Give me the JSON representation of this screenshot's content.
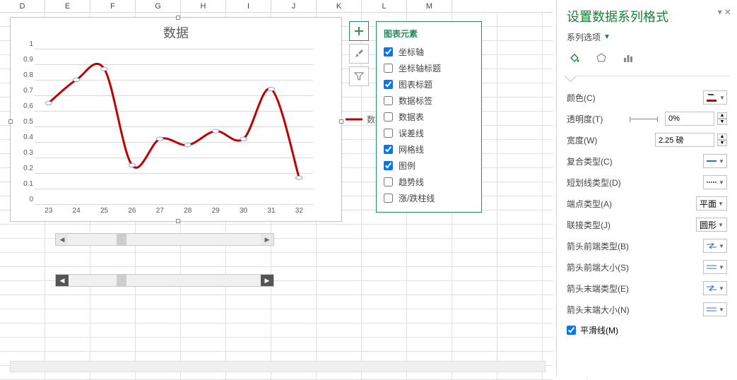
{
  "columns": [
    "D",
    "E",
    "F",
    "G",
    "H",
    "I",
    "J",
    "K",
    "L",
    "M"
  ],
  "chart_data": {
    "type": "line",
    "title": "数据",
    "categories": [
      "23",
      "24",
      "25",
      "26",
      "27",
      "28",
      "29",
      "30",
      "31",
      "32"
    ],
    "series": [
      {
        "name": "数据",
        "values": [
          0.65,
          0.8,
          0.87,
          0.25,
          0.42,
          0.38,
          0.47,
          0.42,
          0.74,
          0.17
        ]
      }
    ],
    "ylim": [
      0,
      1
    ],
    "yticks": [
      "0",
      "0.1",
      "0.2",
      "0.3",
      "0.4",
      "0.5",
      "0.6",
      "0.7",
      "0.8",
      "0.9",
      "1"
    ],
    "xlabel": "",
    "ylabel": "",
    "line_color": "#c00000"
  },
  "flyout": {
    "title": "图表元素",
    "items": [
      {
        "label": "坐标轴",
        "checked": true
      },
      {
        "label": "坐标轴标题",
        "checked": false
      },
      {
        "label": "图表标题",
        "checked": true
      },
      {
        "label": "数据标签",
        "checked": false
      },
      {
        "label": "数据表",
        "checked": false
      },
      {
        "label": "误差线",
        "checked": false
      },
      {
        "label": "网格线",
        "checked": true
      },
      {
        "label": "图例",
        "checked": true
      },
      {
        "label": "趋势线",
        "checked": false
      },
      {
        "label": "涨/跌柱线",
        "checked": false
      }
    ]
  },
  "panel": {
    "title": "设置数据系列格式",
    "subtitle": "系列选项",
    "color_label": "颜色(C)",
    "transparency_label": "透明度(T)",
    "transparency_value": "0%",
    "width_label": "宽度(W)",
    "width_value": "2.25 磅",
    "compound_label": "复合类型(C)",
    "dash_label": "短划线类型(D)",
    "cap_label": "端点类型(A)",
    "cap_value": "平面",
    "join_label": "联接类型(J)",
    "join_value": "圆形",
    "arrow_begin_type_label": "箭头前端类型(B)",
    "arrow_begin_size_label": "箭头前端大小(S)",
    "arrow_end_type_label": "箭头末端类型(E)",
    "arrow_end_size_label": "箭头末端大小(N)",
    "smooth_label": "平滑线(M)",
    "smooth_checked": true
  }
}
